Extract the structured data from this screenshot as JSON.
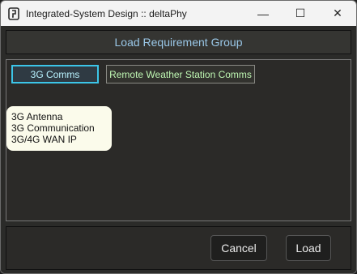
{
  "window": {
    "title": "Integrated-System Design :: deltaPhy",
    "minimize_glyph": "—",
    "maximize_glyph": "☐",
    "close_glyph": "✕"
  },
  "dialog": {
    "title": "Load Requirement Group",
    "tabs": [
      {
        "label": "3G Comms",
        "active": true
      },
      {
        "label": "Remote Weather Station Comms",
        "active": false
      }
    ],
    "items": [
      "3G Antenna",
      "3G Communication",
      "3G/4G WAN IP"
    ],
    "cancel_label": "Cancel",
    "load_label": "Load"
  },
  "colors": {
    "header_text": "#9ac8e8",
    "active_tab_border": "#3cc5e8",
    "inactive_tab_text": "#bff7b3",
    "popup_bg": "#fbfbeb"
  }
}
